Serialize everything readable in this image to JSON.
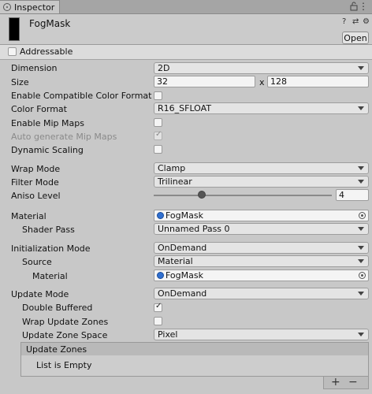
{
  "tab": {
    "title": "Inspector",
    "icon": "info-icon"
  },
  "header": {
    "asset_name": "FogMask",
    "open_label": "Open",
    "help_icon": "?",
    "settings_icon": "⚙"
  },
  "addressable": {
    "label": "Addressable",
    "checked": false
  },
  "fields": {
    "dimension": {
      "label": "Dimension",
      "value": "2D"
    },
    "size": {
      "label": "Size",
      "width": "32",
      "separator": "x",
      "height": "128"
    },
    "enable_compat": {
      "label": "Enable Compatible Color Format",
      "checked": false
    },
    "color_format": {
      "label": "Color Format",
      "value": "R16_SFLOAT"
    },
    "enable_mipmaps": {
      "label": "Enable Mip Maps",
      "checked": false
    },
    "auto_mipmaps": {
      "label": "Auto generate Mip Maps",
      "checked": true
    },
    "dynamic_scaling": {
      "label": "Dynamic Scaling",
      "checked": false
    },
    "wrap_mode": {
      "label": "Wrap Mode",
      "value": "Clamp"
    },
    "filter_mode": {
      "label": "Filter Mode",
      "value": "Trilinear"
    },
    "aniso_level": {
      "label": "Aniso Level",
      "value": "4",
      "slider_fraction": 0.27
    },
    "material": {
      "label": "Material",
      "value": "FogMask"
    },
    "shader_pass": {
      "label": "Shader Pass",
      "value": "Unnamed Pass 0"
    },
    "init_mode": {
      "label": "Initialization Mode",
      "value": "OnDemand"
    },
    "source": {
      "label": "Source",
      "value": "Material"
    },
    "source_material": {
      "label": "Material",
      "value": "FogMask"
    },
    "update_mode": {
      "label": "Update Mode",
      "value": "OnDemand"
    },
    "double_buffered": {
      "label": "Double Buffered",
      "checked": true
    },
    "wrap_update_zones": {
      "label": "Wrap Update Zones",
      "checked": false
    },
    "update_zone_space": {
      "label": "Update Zone Space",
      "value": "Pixel"
    }
  },
  "update_zones": {
    "title": "Update Zones",
    "empty_text": "List is Empty",
    "add_label": "+",
    "remove_label": "−"
  }
}
